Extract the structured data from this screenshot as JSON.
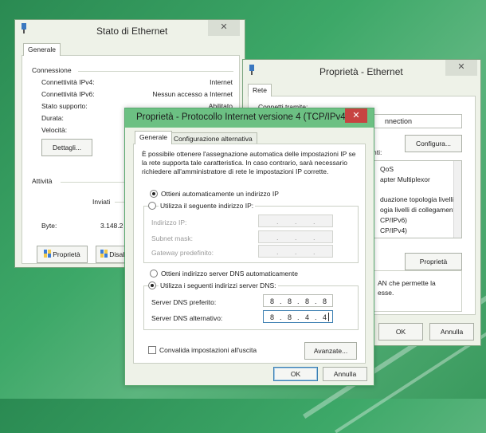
{
  "colors": {
    "dialog_border": "#58a86e",
    "dialog_title_bg": "#6cc083",
    "close_red": "#c74341",
    "accent_blue": "#3c7fb1"
  },
  "stato": {
    "title": "Stato di Ethernet",
    "close_glyph": "✕",
    "tab": "Generale",
    "connection_header": "Connessione",
    "rows": [
      {
        "label": "Connettività IPv4:",
        "value": "Internet"
      },
      {
        "label": "Connettività IPv6:",
        "value": "Nessun accesso a Internet"
      },
      {
        "label": "Stato supporto:",
        "value": "Abilitato"
      },
      {
        "label": "Durata:",
        "value": ""
      },
      {
        "label": "Velocità:",
        "value": ""
      }
    ],
    "details_btn": "Dettagli...",
    "activity_header": "Attività",
    "sent_label": "Inviati",
    "bytes_label": "Byte:",
    "bytes_value": "3.148.2",
    "props_btn": "Proprietà",
    "disable_btn": "Disabilita"
  },
  "eth": {
    "title": "Proprietà - Ethernet",
    "close_glyph": "✕",
    "tab": "Rete",
    "connect_label": "Connetti tramite:",
    "adapter": "nnection",
    "configure_btn": "Configura...",
    "items_label": "nti:",
    "items": [
      "QoS",
      "apter Multiplexor",
      "",
      "duazione topologia livelli c",
      "ogia livelli di collegamento",
      "CP/IPv6)",
      "CP/IPv4)"
    ],
    "props_btn": "Proprietà",
    "desc": "AN che permette la\nesse.",
    "ok_btn": "OK",
    "cancel_btn": "Annulla"
  },
  "ipv4": {
    "title": "Proprietà - Protocollo Internet versione 4 (TCP/IPv4)",
    "close_glyph": "✕",
    "tabs": [
      "Generale",
      "Configurazione alternativa"
    ],
    "intro": "È possibile ottenere l'assegnazione automatica delle impostazioni IP se la rete supporta tale caratteristica. In caso contrario, sarà necessario richiedere all'amministratore di rete le impostazioni IP corrette.",
    "auto_ip": "Ottieni automaticamente un indirizzo IP",
    "manual_ip": "Utilizza il seguente indirizzo IP:",
    "ip_label": "Indirizzo IP:",
    "mask_label": "Subnet mask:",
    "gw_label": "Gateway predefinito:",
    "auto_dns": "Ottieni indirizzo server DNS automaticamente",
    "manual_dns": "Utilizza i seguenti indirizzi server DNS:",
    "dns1_label": "Server DNS preferito:",
    "dns2_label": "Server DNS alternativo:",
    "dns1": [
      "8",
      "8",
      "8",
      "8"
    ],
    "dns2": [
      "8",
      "8",
      "4",
      "4"
    ],
    "empty_ip": [
      ".",
      ".",
      "."
    ],
    "validate": "Convalida impostazioni all'uscita",
    "advanced_btn": "Avanzate...",
    "ok_btn": "OK",
    "cancel_btn": "Annulla"
  }
}
